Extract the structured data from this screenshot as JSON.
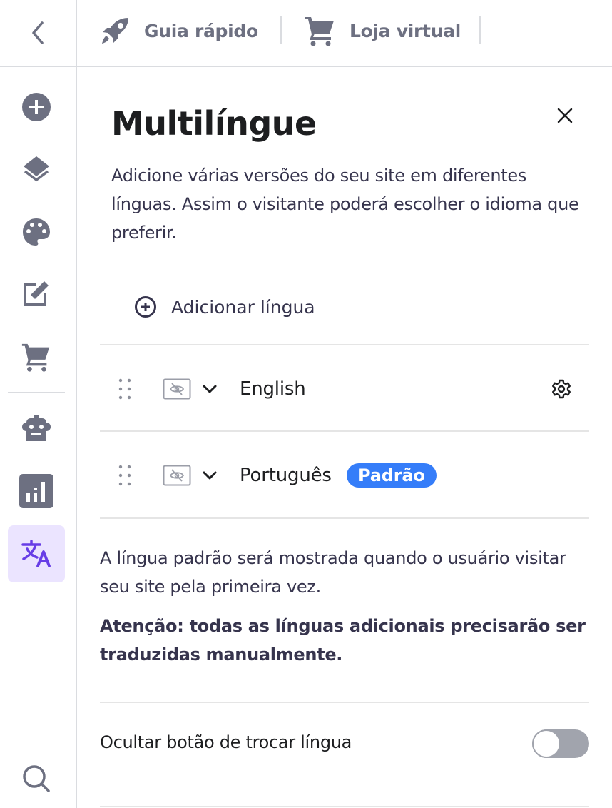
{
  "topbar": {
    "back_icon": "chevron-left-icon",
    "links": [
      {
        "label": "Guia rápido",
        "icon": "rocket-icon"
      },
      {
        "label": "Loja virtual",
        "icon": "cart-icon"
      }
    ]
  },
  "sidebar": {
    "items": [
      {
        "name": "add-element",
        "icon": "plus-circle-icon",
        "active": false
      },
      {
        "name": "layers",
        "icon": "layers-icon",
        "active": false
      },
      {
        "name": "styles",
        "icon": "palette-icon",
        "active": false
      },
      {
        "name": "edit-pages",
        "icon": "edit-icon",
        "active": false
      },
      {
        "name": "store",
        "icon": "cart-icon",
        "active": false
      },
      {
        "name": "ai-tools",
        "icon": "robot-icon",
        "active": false
      },
      {
        "name": "analytics",
        "icon": "analytics-icon",
        "active": false
      },
      {
        "name": "multilingual",
        "icon": "translate-icon",
        "active": true
      },
      {
        "name": "search",
        "icon": "search-icon",
        "active": false
      }
    ]
  },
  "panel": {
    "title": "Multilíngue",
    "description": "Adicione várias versões do seu site em diferentes línguas. Assim o visitante poderá escolher o idioma que preferir.",
    "add_language_label": "Adicionar língua",
    "languages": [
      {
        "name": "English",
        "default": false,
        "hidden": true
      },
      {
        "name": "Português",
        "default": true,
        "hidden": true,
        "badge": "Padrão"
      }
    ],
    "info_text": "A língua padrão será mostrada quando o usuário visitar seu site pela primeira vez.",
    "warning_text": "Atenção: todas as línguas adicionais precisarão ser traduzidas manualmente.",
    "toggle": {
      "label": "Ocultar botão de trocar língua",
      "on": false
    }
  },
  "colors": {
    "accent": "#357df9",
    "active_bg": "#ebe4ff",
    "active_icon": "#673de6",
    "icon_gray": "#6d7081"
  }
}
